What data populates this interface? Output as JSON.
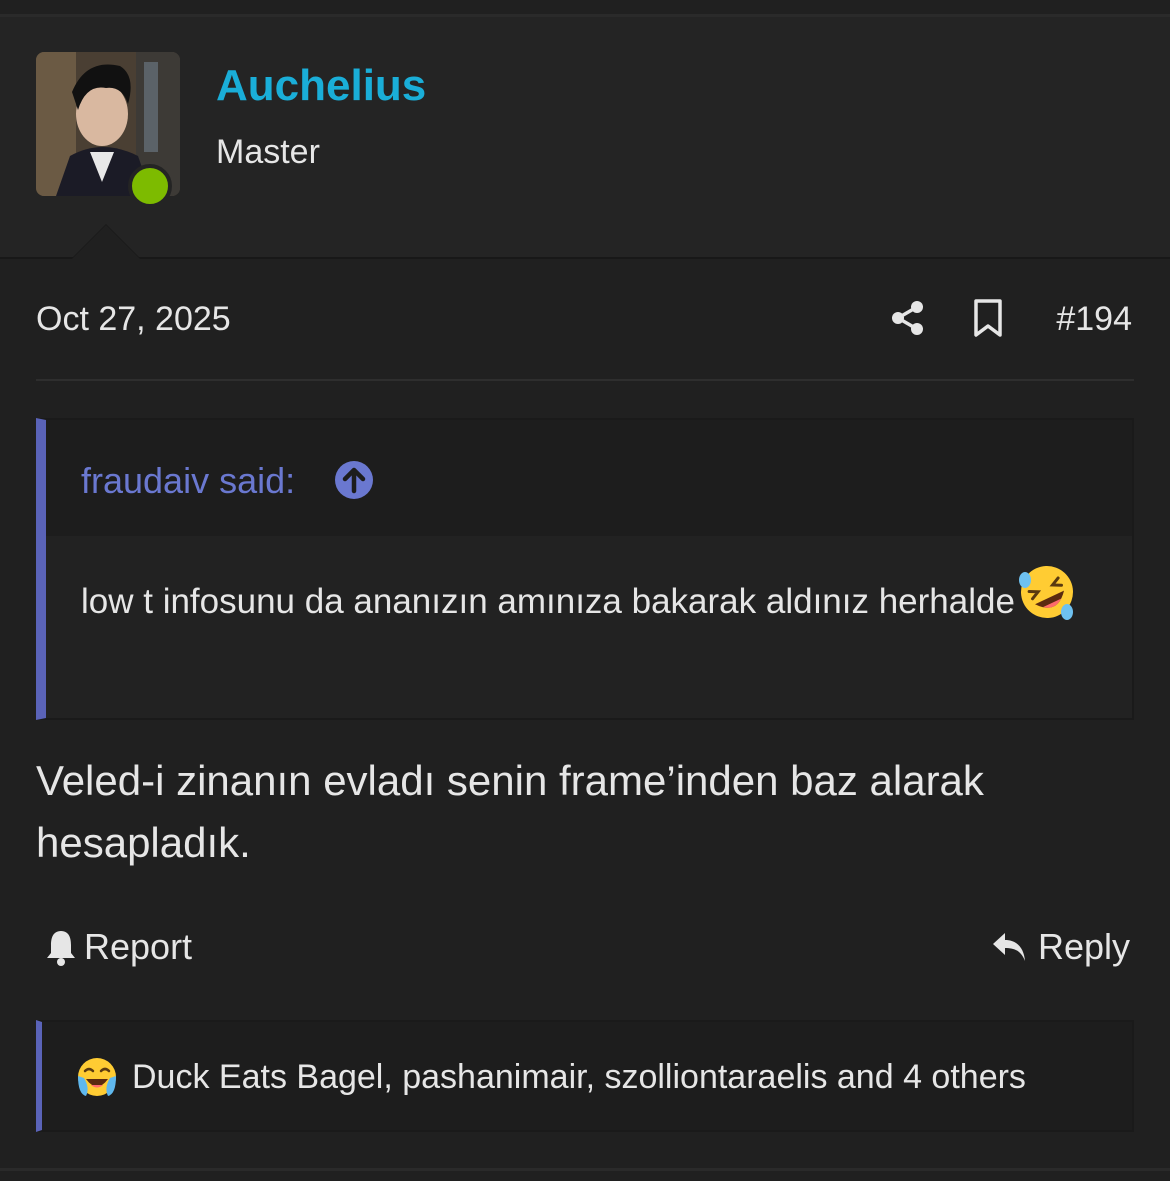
{
  "user": {
    "name": "Auchelius",
    "title": "Master",
    "online": true
  },
  "post": {
    "date": "Oct 27, 2025",
    "number": "#194",
    "body": "Veled-i zinanın evladı senin frame’inden baz alarak hesapladık."
  },
  "quote": {
    "author_label": "fraudaiv said:",
    "text": "low t infosunu da ananızın amınıza bakarak aldınız herhalde"
  },
  "actions": {
    "report_label": "Report",
    "reply_label": "Reply"
  },
  "reactions": {
    "text": "Duck Eats Bagel, pashanimair, szolliontaraelis and 4 others"
  },
  "icons": {
    "share": "share-icon",
    "bookmark": "bookmark-icon",
    "jump": "arrow-up-circle-icon",
    "report": "bell-icon",
    "reply": "reply-icon",
    "quote_emoji": "rolling-on-floor-laughing-emoji",
    "reaction_emoji": "loudly-crying-laughing-emoji"
  },
  "colors": {
    "username": "#1aaed8",
    "online": "#7dbb00",
    "quote_accent": "#5a63b8",
    "quote_author": "#6a78d0"
  }
}
